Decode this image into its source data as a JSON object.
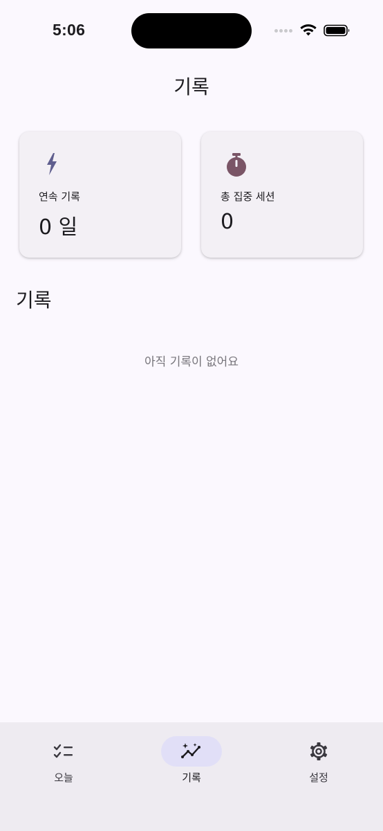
{
  "status_bar": {
    "time": "5:06"
  },
  "header": {
    "title": "기록"
  },
  "stats": [
    {
      "icon": "lightning-bolt-icon",
      "label": "연속 기록",
      "value": "0 일",
      "icon_color": "#5F5E8E"
    },
    {
      "icon": "stopwatch-icon",
      "label": "총 집중 세션",
      "value": "0",
      "icon_color": "#7A5566"
    }
  ],
  "records": {
    "title": "기록",
    "empty_message": "아직 기록이 없어요"
  },
  "nav": {
    "items": [
      {
        "label": "오늘",
        "icon": "checklist-icon",
        "active": false
      },
      {
        "label": "기록",
        "icon": "trend-sparkle-icon",
        "active": true
      },
      {
        "label": "설정",
        "icon": "gear-icon",
        "active": false
      }
    ]
  },
  "colors": {
    "background": "#FBF8FE",
    "card": "#F3F0F5",
    "nav_bar": "#EEEBF1",
    "nav_active_pill": "#E1DFF7"
  }
}
